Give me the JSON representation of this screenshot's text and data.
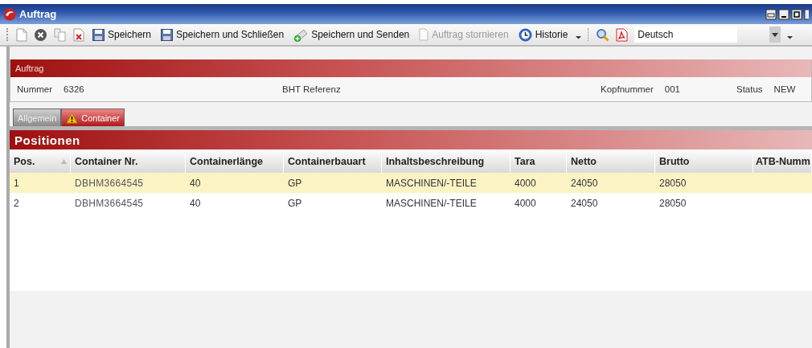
{
  "window": {
    "title": "Auftrag"
  },
  "toolbar": [
    {
      "kind": "new"
    },
    {
      "kind": "cancel"
    },
    {
      "kind": "copy"
    },
    {
      "kind": "delete"
    },
    {
      "kind": "save",
      "label": "Speichern",
      "disabled": false
    },
    {
      "kind": "save",
      "label": "Speichern und Schließen",
      "disabled": false
    },
    {
      "kind": "send",
      "label": "Speichern und Senden",
      "disabled": false
    },
    {
      "kind": "document",
      "label": "Auftrag stornieren",
      "disabled": true
    },
    {
      "kind": "history",
      "label": "Historie",
      "disabled": false
    },
    {
      "kind": "caret"
    },
    {
      "kind": "separator"
    },
    {
      "kind": "search"
    },
    {
      "kind": "pdf"
    },
    {
      "kind": "select",
      "value": "Deutsch"
    }
  ],
  "header": {
    "title": "Auftrag",
    "fields": [
      {
        "label": "Nummer",
        "value": "6326"
      },
      {
        "label": "BHT Referenz"
      },
      {
        "label": "Kopfnummer",
        "value": "001"
      },
      {
        "label": "Status",
        "value": "NEW"
      }
    ]
  },
  "tabs": [
    {
      "label": "Allgemein",
      "selected": false,
      "warning": false
    },
    {
      "label": "Container",
      "selected": true,
      "warning": true
    }
  ],
  "positions": {
    "title": "Positionen",
    "columns": [
      "Pos.",
      "Container Nr.",
      "Containerlänge",
      "Containerbauart",
      "Inhaltsbeschreibung",
      "Tara",
      "Netto",
      "Brutto",
      "ATB-Numm"
    ],
    "rows": [
      {
        "selected": true,
        "cells": [
          "1",
          "DBHM3664545",
          "40",
          "GP",
          "MASCHINEN/-TEILE",
          "4000",
          "24050",
          "28050"
        ]
      },
      {
        "selected": false,
        "cells": [
          "2",
          "DBHM3664545",
          "40",
          "GP",
          "MASCHINEN/-TEILE",
          "4000",
          "24050",
          "28050"
        ]
      }
    ]
  }
}
